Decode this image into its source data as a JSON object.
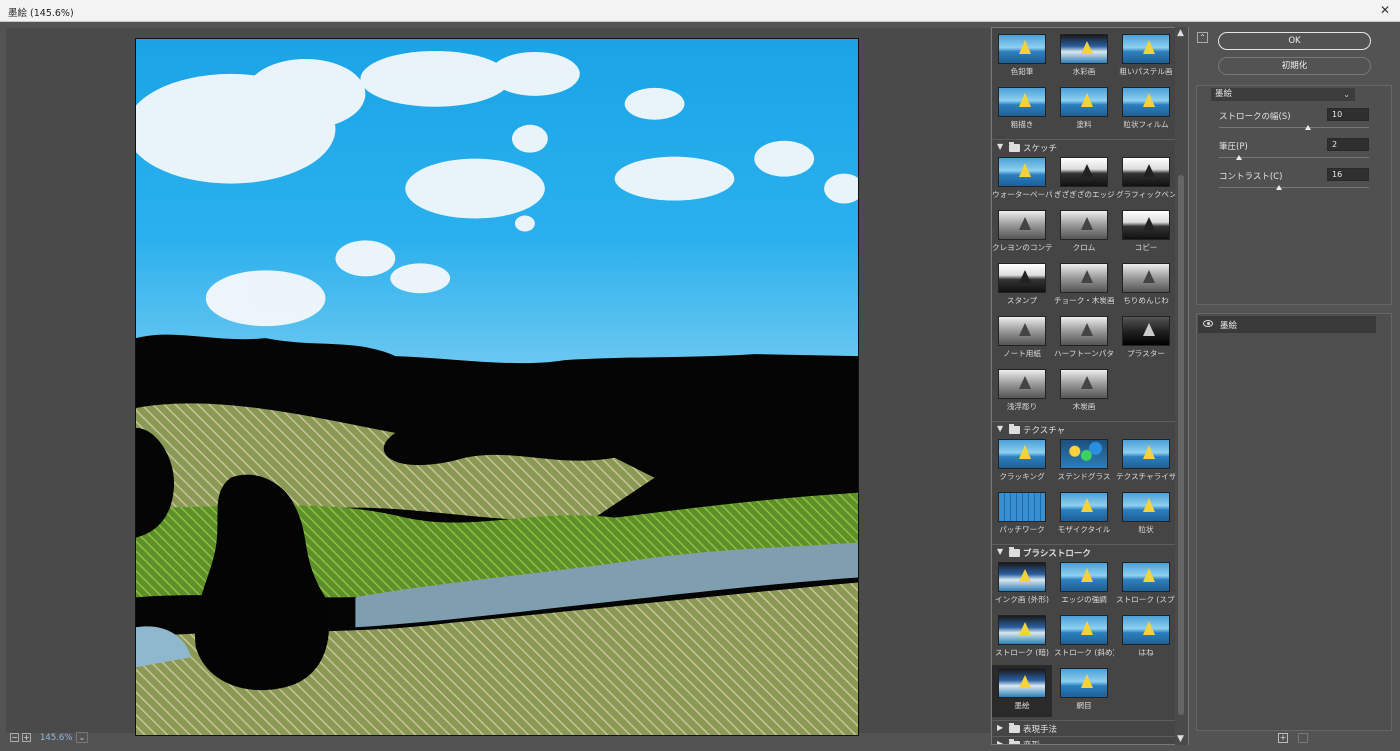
{
  "window": {
    "title": "墨絵 (145.6%)",
    "close": "✕"
  },
  "preview": {
    "zoom_text": "145.6%",
    "zoom_minus": "−",
    "zoom_plus": "+",
    "zoom_dropdown": "⌄"
  },
  "gallery": {
    "top_tiles": [
      {
        "label": "色鉛筆",
        "thumb": "th-color"
      },
      {
        "label": "水彩画",
        "thumb": "th-ink"
      },
      {
        "label": "粗いパステル画",
        "thumb": "th-color"
      },
      {
        "label": "粗描き",
        "thumb": "th-color"
      },
      {
        "label": "塗料",
        "thumb": "th-color"
      },
      {
        "label": "粒状フィルム",
        "thumb": "th-color"
      }
    ],
    "sections": [
      {
        "name": "スケッチ",
        "expanded": true,
        "arrow": "▼",
        "items": [
          {
            "label": "ウォーターペーパー",
            "thumb": "th-color"
          },
          {
            "label": "ぎざぎざのエッジ",
            "thumb": "th-bw"
          },
          {
            "label": "グラフィックペン",
            "thumb": "th-bw"
          },
          {
            "label": "クレヨンのコンテ画",
            "thumb": "th-gray"
          },
          {
            "label": "クロム",
            "thumb": "th-gray"
          },
          {
            "label": "コピー",
            "thumb": "th-bw"
          },
          {
            "label": "スタンプ",
            "thumb": "th-bw"
          },
          {
            "label": "チョーク・木炭画",
            "thumb": "th-gray"
          },
          {
            "label": "ちりめんじわ",
            "thumb": "th-gray"
          },
          {
            "label": "ノート用紙",
            "thumb": "th-gray"
          },
          {
            "label": "ハーフトーンパターン",
            "thumb": "th-gray"
          },
          {
            "label": "プラスター",
            "thumb": "th-dark"
          },
          {
            "label": "浅浮彫り",
            "thumb": "th-gray"
          },
          {
            "label": "木炭画",
            "thumb": "th-gray"
          }
        ]
      },
      {
        "name": "テクスチャ",
        "expanded": true,
        "arrow": "▼",
        "items": [
          {
            "label": "クラッキング",
            "thumb": "th-color"
          },
          {
            "label": "ステンドグラス",
            "thumb": "th-stain"
          },
          {
            "label": "テクスチャライザー",
            "thumb": "th-color"
          },
          {
            "label": "パッチワーク",
            "thumb": "th-patch"
          },
          {
            "label": "モザイクタイル",
            "thumb": "th-color"
          },
          {
            "label": "粒状",
            "thumb": "th-color"
          }
        ]
      },
      {
        "name": "ブラシストローク",
        "expanded": true,
        "arrow": "▼",
        "items": [
          {
            "label": "インク画 (外形)",
            "thumb": "th-ink"
          },
          {
            "label": "エッジの強調",
            "thumb": "th-color"
          },
          {
            "label": "ストローク (スプレー)",
            "thumb": "th-color"
          },
          {
            "label": "ストローク (暗)",
            "thumb": "th-ink"
          },
          {
            "label": "ストローク (斜め)",
            "thumb": "th-color"
          },
          {
            "label": "はね",
            "thumb": "th-color"
          },
          {
            "label": "墨絵",
            "thumb": "th-ink",
            "selected": true
          },
          {
            "label": "網目",
            "thumb": "th-color"
          }
        ]
      },
      {
        "name": "表現手法",
        "expanded": false,
        "arrow": "▶",
        "items": []
      },
      {
        "name": "変形",
        "expanded": false,
        "arrow": "▶",
        "items": []
      }
    ],
    "scroll_up": "▲",
    "scroll_down": "▼"
  },
  "settings": {
    "collapse": "⌃",
    "ok_label": "OK",
    "reset_label": "初期化",
    "filter_select": "墨絵",
    "filter_select_chevron": "⌄",
    "params": [
      {
        "label": "ストロークの幅(S)",
        "value": "10",
        "fraction": 0.59
      },
      {
        "label": "筆圧(P)",
        "value": "2",
        "fraction": 0.13
      },
      {
        "label": "コントラスト(C)",
        "value": "16",
        "fraction": 0.4
      }
    ],
    "layer_name": "墨絵",
    "new_layer": "+",
    "delete_layer": "🗑"
  }
}
